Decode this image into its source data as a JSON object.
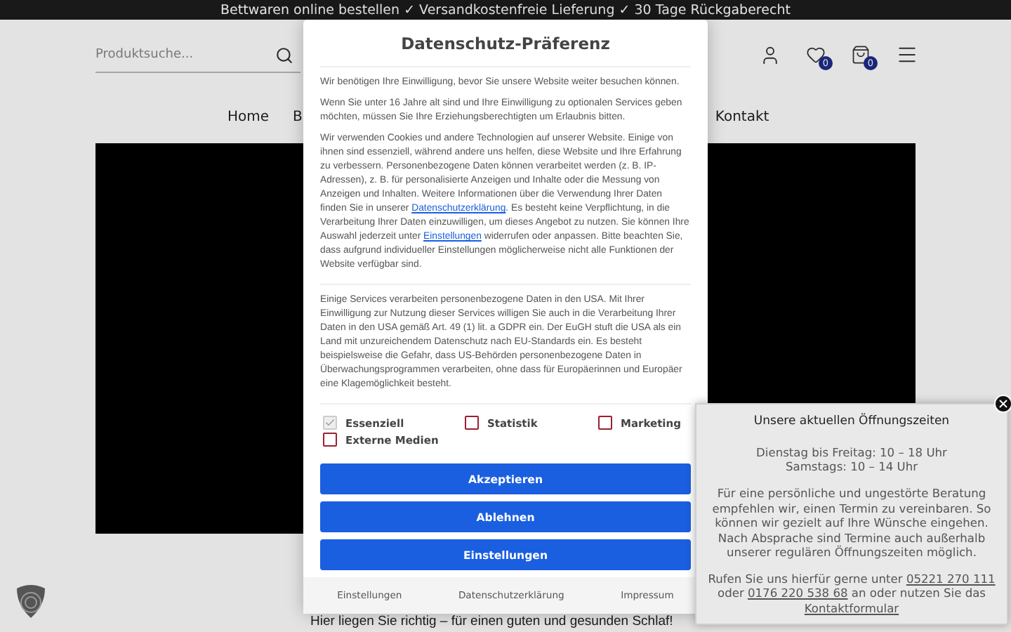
{
  "top_banner": {
    "text": "Bettwaren online bestellen ✓ Versandkostenfreie Lieferung ✓ 30 Tage Rückgaberecht"
  },
  "header": {
    "search": {
      "placeholder": "Produktsuche..."
    },
    "wishlist_count": "0",
    "cart_count": "0"
  },
  "nav": [
    "Home",
    "B",
    "Kontakt"
  ],
  "tagline": "Hier liegen Sie richtig – für einen guten und gesunden Schlaf!",
  "cookie_dialog": {
    "title": "Datenschutz-Präferenz",
    "paragraphs": [
      [
        {
          "text": "Wir benötigen Ihre Einwilligung, bevor Sie unsere Website weiter besuchen können.",
          "link": false
        }
      ],
      [
        {
          "text": "Wenn Sie unter 16 Jahre alt sind und Ihre Einwilligung zu optionalen Services geben möchten, müssen Sie Ihre Erziehungsberechtigten um Erlaubnis bitten.",
          "link": false
        }
      ],
      [
        {
          "text": "Wir verwenden Cookies und andere Technologien auf unserer Website. Einige von ihnen sind essenziell, während andere uns helfen, diese Website und Ihre Erfahrung zu verbessern. Personenbezogene Daten können verarbeitet werden (z. B. IP-Adressen), z. B. für personalisierte Anzeigen und Inhalte oder die Messung von Anzeigen und Inhalten. Weitere Informationen über die Verwendung Ihrer Daten finden Sie in unserer ",
          "link": false
        },
        {
          "text": "Datenschutzerklärung",
          "link": true
        },
        {
          "text": ". Es besteht keine Verpflichtung, in die Verarbeitung Ihrer Daten einzuwilligen, um dieses Angebot zu nutzen. Sie können Ihre Auswahl jederzeit unter ",
          "link": false
        },
        {
          "text": "Einstellungen",
          "link": true
        },
        {
          "text": " widerrufen oder anpassen. Bitte beachten Sie, dass aufgrund individueller Einstellungen möglicherweise nicht alle Funktionen der Website verfügbar sind.",
          "link": false
        }
      ],
      [
        {
          "text": "Einige Services verarbeiten personenbezogene Daten in den USA. Mit Ihrer Einwilligung zur Nutzung dieser Services willigen Sie auch in die Verarbeitung Ihrer Daten in den USA gemäß Art. 49 (1) lit. a GDPR ein. Der EuGH stuft die USA als ein Land mit unzureichendem Datenschutz nach EU-Standards ein. Es besteht beispielsweise die Gefahr, dass US-Behörden personenbezogene Daten in Überwachungsprogrammen verarbeiten, ohne dass für Europäerinnen und Europäer eine Klagemöglichkeit besteht.",
          "link": false
        }
      ]
    ],
    "categories": [
      {
        "label": "Essenziell",
        "checked": true,
        "disabled": true
      },
      {
        "label": "Statistik",
        "checked": false,
        "disabled": false
      },
      {
        "label": "Marketing",
        "checked": false,
        "disabled": false
      },
      {
        "label": "Externe Medien",
        "checked": false,
        "disabled": false
      }
    ],
    "buttons": [
      "Akzeptieren",
      "Ablehnen",
      "Einstellungen"
    ],
    "footer_links": [
      "Einstellungen",
      "Datenschutzerklärung",
      "Impressum"
    ]
  },
  "hours_popup": {
    "title": "Unsere aktuellen Öffnungszeiten",
    "hours": [
      "Dienstag bis Freitag: 10 – 18 Uhr",
      "Samstags: 10 – 14 Uhr"
    ],
    "text": "Für eine persönliche und ungestörte Beratung empfehlen wir, einen Termin zu vereinbaren. So können wir gezielt auf Ihre Wünsche eingehen. Nach Absprache sind Termine auch außerhalb unserer regulären Öffnungszeiten möglich.",
    "contact": [
      {
        "text": "Rufen Sie uns hierfür gerne unter ",
        "link": false
      },
      {
        "text": "05221 270 111",
        "link": true
      },
      {
        "text": " oder ",
        "link": false
      },
      {
        "text": "0176 220 538 68",
        "link": true
      },
      {
        "text": " an oder nutzen Sie das ",
        "link": false
      },
      {
        "text": "Kontaktformular",
        "link": true
      }
    ]
  }
}
